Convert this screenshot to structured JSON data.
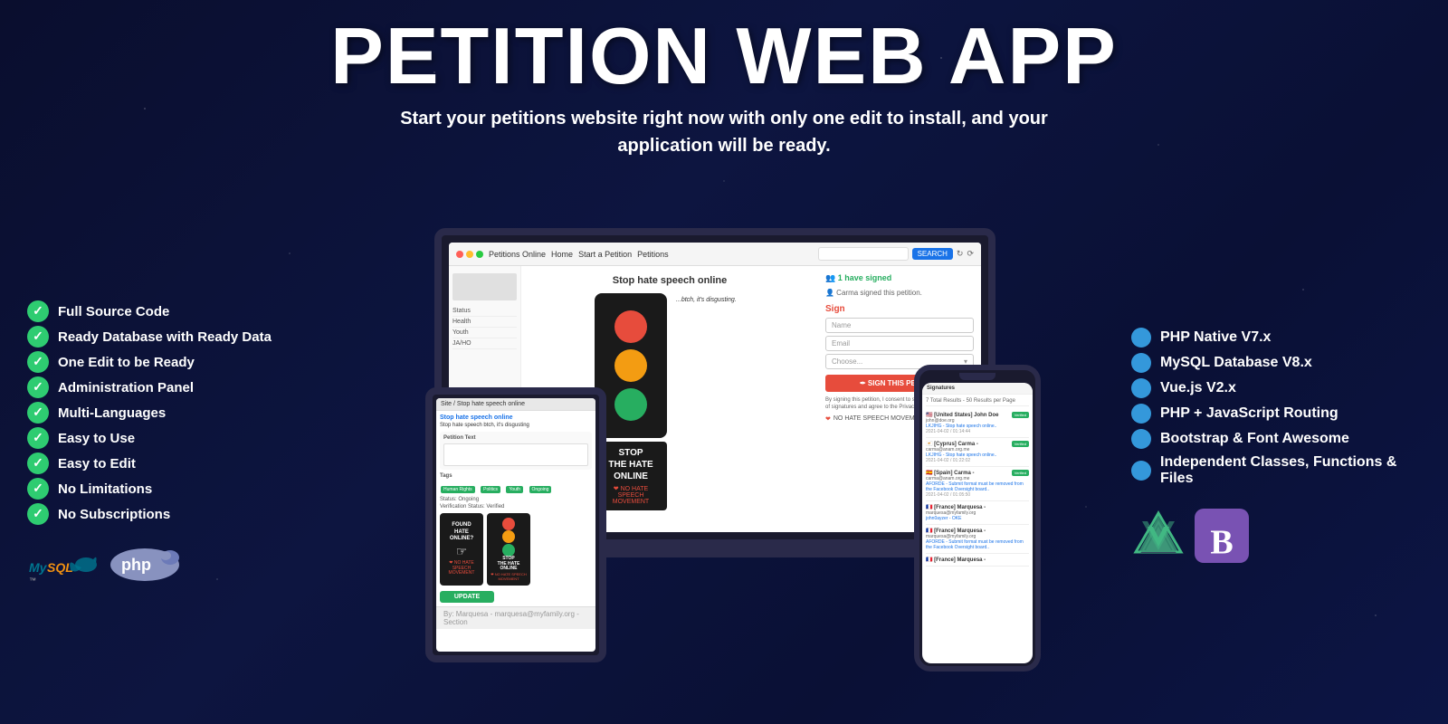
{
  "header": {
    "title": "Petition Web App",
    "subtitle": "Start your petitions website right now with only one edit to install, and your application will be ready."
  },
  "left_features": {
    "items": [
      "Full Source Code",
      "Ready Database with Ready Data",
      "One Edit to be Ready",
      "Administration Panel",
      "Multi-Languages",
      "Easy to Use",
      "Easy to Edit",
      "No Limitations",
      "No Subscriptions"
    ]
  },
  "right_features": {
    "items": [
      "PHP Native V7.x",
      "MySQL Database V8.x",
      "Vue.js V2.x",
      "PHP + JavaScript Routing",
      "Bootstrap & Font Awesome",
      "Independent Classes, Functions & Files"
    ]
  },
  "mockup": {
    "browser": {
      "site_name": "Petitions Online",
      "nav_items": [
        "Home",
        "Start a Petition",
        "Petitions"
      ],
      "search_placeholder": "Search",
      "search_button": "SEARCH"
    },
    "petition": {
      "title": "Stop hate speech online",
      "signed_count": "1 have signed",
      "signer_name": "Carma signed this petition.",
      "sign_label": "Sign",
      "name_placeholder": "Name",
      "email_placeholder": "Email",
      "country_placeholder": "Choose...",
      "cta_button": "✒ SIGN THIS PETITION",
      "no_hate_text": "NO HATE SPEECH MOVEMENT",
      "stop_text": "STOP THE HATE ONLINE"
    },
    "tablet": {
      "header": "Site / Stop hate speech online",
      "title": "Stop hate speech online",
      "subtitle": "Stop hate speech btch, it's disgusting",
      "tags": [
        "Human Rights",
        "Politics",
        "Youth",
        "Ongoing"
      ],
      "status": "Status: Ongoing",
      "verification": "Verification Status: Verified",
      "footer_text": "By: Marquesa - marquesa@myfamily.org - Section"
    },
    "phone": {
      "header": "Signatures",
      "total": "7 Total Results - 50 Results per Page",
      "entries": [
        {
          "location": "United States] John Doe",
          "email": "john@doe.org",
          "link": "LKJIHG - Stop hate speech online..",
          "date": "2021-04-02 / 01:14:44",
          "verified": true
        },
        {
          "location": "Cyprus] Carma -",
          "email": "carma@anam.org.me",
          "link": "LKJIHG - Stop hate speech online..",
          "date": "2021-04-02 / 01:22:02",
          "verified": true
        },
        {
          "location": "Spain] Carma -",
          "email": "carma@anam.org.me",
          "link": "AFORDE - Submit format must be removed from the Facebook Oversight board..",
          "date": "2021-04-02 / 01:05:50",
          "verified": true
        },
        {
          "location": "France] Marquesa -",
          "email": "marquesa@myfamily.org",
          "link": "john0ayzer - OKE",
          "date": "",
          "verified": false
        },
        {
          "location": "France] Marquesa -",
          "email": "marquesa@myfamily.org",
          "link": "AFORDE - Submit format must be removed from the Facebook Oversight board..",
          "date": "",
          "verified": false
        },
        {
          "location": "France] Marquesa -",
          "email": "",
          "link": "",
          "date": "",
          "verified": false
        }
      ]
    }
  },
  "logos": {
    "mysql": "MySQL",
    "php": "php"
  }
}
